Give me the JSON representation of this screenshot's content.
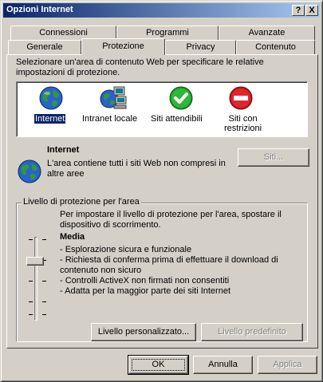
{
  "window": {
    "title": "Opzioni Internet",
    "help_glyph": "?",
    "close_glyph": "X"
  },
  "tabs_back": [
    "Connessioni",
    "Programmi",
    "Avanzate"
  ],
  "tabs_front": [
    "Generale",
    "Protezione",
    "Privacy",
    "Contenuto"
  ],
  "active_tab": "Protezione",
  "zones_intro": "Selezionare un'area di contenuto Web per specificare le relative impostazioni di protezione.",
  "zones": [
    {
      "label": "Internet",
      "icon": "globe-icon",
      "selected": true
    },
    {
      "label": "Intranet locale",
      "icon": "intranet-icon",
      "selected": false
    },
    {
      "label": "Siti attendibili",
      "icon": "check-icon",
      "selected": false
    },
    {
      "label": "Siti con\nrestrizioni",
      "icon": "restricted-icon",
      "selected": false
    }
  ],
  "zone_detail": {
    "name": "Internet",
    "description": "L'area contiene tutti i siti Web non compresi in altre aree",
    "sites_button": "Siti..."
  },
  "security_level": {
    "group_title": "Livello di protezione per l'area",
    "instruction": "Per impostare il livello di protezione per l'area, spostare il dispositivo di scorrimento.",
    "level_name": "Media",
    "bullets": [
      "- Esplorazione sicura e funzionale",
      "- Richiesta di conferma prima di effettuare il download di contenuto non sicuro",
      "- Controlli ActiveX non firmati non consentiti",
      "- Adatta per la maggior parte dei siti Internet"
    ],
    "custom_button": "Livello personalizzato...",
    "default_button": "Livello predefinito"
  },
  "footer": {
    "ok": "OK",
    "cancel": "Annulla",
    "apply": "Applica"
  },
  "colors": {
    "titlebar_start": "#0a246a",
    "titlebar_end": "#a6caf0",
    "face": "#d4d0c8",
    "selection": "#0a246a"
  }
}
